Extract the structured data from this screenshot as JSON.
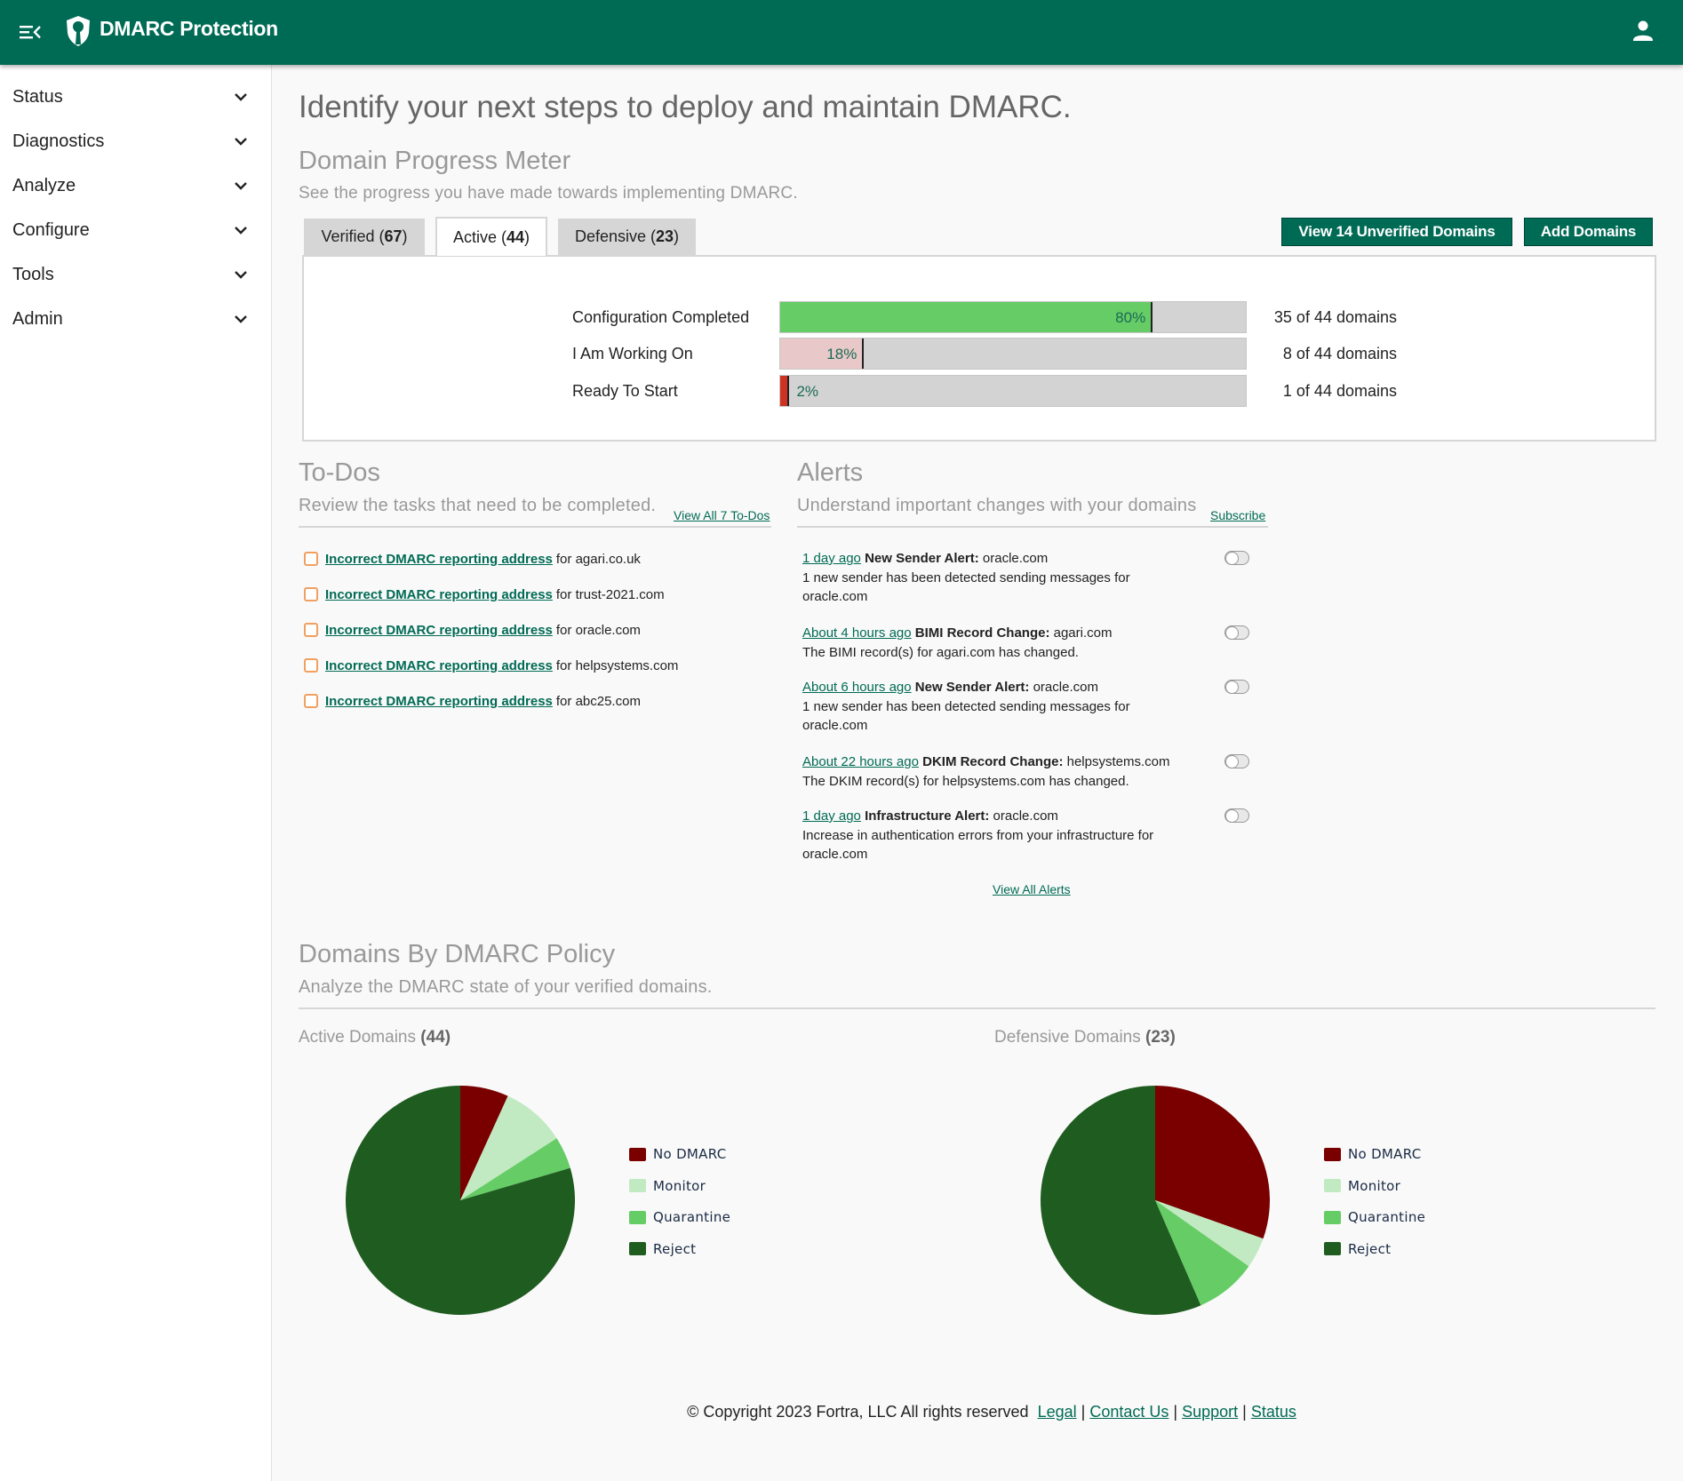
{
  "header": {
    "app_title": "DMARC Protection"
  },
  "sidebar": {
    "items": [
      {
        "label": "Status"
      },
      {
        "label": "Diagnostics"
      },
      {
        "label": "Analyze"
      },
      {
        "label": "Configure"
      },
      {
        "label": "Tools"
      },
      {
        "label": "Admin"
      }
    ]
  },
  "page": {
    "title": "Identify your next steps to deploy and maintain DMARC."
  },
  "progress_meter": {
    "title": "Domain Progress Meter",
    "subtitle": "See the progress you have made towards implementing DMARC.",
    "tabs": [
      {
        "label": "Verified",
        "count": "(67)",
        "count_num": "67",
        "active": false
      },
      {
        "label": "Active",
        "count": "(44)",
        "count_num": "44",
        "active": true
      },
      {
        "label": "Defensive",
        "count": "(23)",
        "count_num": "23",
        "active": false
      }
    ],
    "buttons": {
      "view_unverified": "View 14 Unverified Domains",
      "add_domains": "Add Domains"
    },
    "rows": [
      {
        "label": "Configuration Completed",
        "percent": 80,
        "percent_label": "80%",
        "count_label": "35 of 44 domains",
        "color": "#66cc66"
      },
      {
        "label": "I Am Working On",
        "percent": 18,
        "percent_label": "18%",
        "count_label": "8 of 44 domains",
        "color": "#e8c8c8"
      },
      {
        "label": "Ready To Start",
        "percent": 2,
        "percent_label": "2%",
        "count_label": "1 of 44 domains",
        "color": "#cc3322"
      }
    ]
  },
  "todos": {
    "title": "To-Dos",
    "subtitle": "Review the tasks that need to be completed.",
    "view_all": "View All 7 To-Dos",
    "items": [
      {
        "link": "Incorrect DMARC reporting address",
        "suffix": "for agari.co.uk"
      },
      {
        "link": "Incorrect DMARC reporting address",
        "suffix": "for trust-2021.com"
      },
      {
        "link": "Incorrect DMARC reporting address",
        "suffix": "for oracle.com"
      },
      {
        "link": "Incorrect DMARC reporting address",
        "suffix": "for helpsystems.com"
      },
      {
        "link": "Incorrect DMARC reporting address",
        "suffix": "for abc25.com"
      }
    ]
  },
  "alerts": {
    "title": "Alerts",
    "subtitle": "Understand important changes with your domains",
    "subscribe": "Subscribe",
    "view_all": "View All Alerts",
    "items": [
      {
        "time": "1 day ago",
        "type": "New Sender Alert:",
        "domain": "oracle.com",
        "description": "1 new sender has been detected sending messages for oracle.com",
        "enabled": false
      },
      {
        "time": "About 4 hours ago",
        "type": "BIMI Record Change:",
        "domain": "agari.com",
        "description": "The BIMI record(s) for agari.com has changed.",
        "enabled": false
      },
      {
        "time": "About 6 hours ago",
        "type": "New Sender Alert:",
        "domain": "oracle.com",
        "description": "1 new sender has been detected sending messages for oracle.com",
        "enabled": false
      },
      {
        "time": "About 22 hours ago",
        "type": "DKIM Record Change:",
        "domain": "helpsystems.com",
        "description": "The DKIM record(s) for helpsystems.com has changed.",
        "enabled": false
      },
      {
        "time": "1 day ago",
        "type": "Infrastructure Alert:",
        "domain": "oracle.com",
        "description": "Increase in authentication errors from your infrastructure for oracle.com",
        "enabled": false
      }
    ]
  },
  "policy": {
    "title": "Domains By DMARC Policy",
    "subtitle": "Analyze the DMARC state of your verified domains."
  },
  "chart_data": [
    {
      "type": "pie",
      "title": "Active Domains",
      "title_count": "(44)",
      "categories": [
        "No DMARC",
        "Monitor",
        "Quarantine",
        "Reject"
      ],
      "values": [
        3,
        4,
        2,
        35
      ],
      "colors": [
        "#7a0000",
        "#c2eac2",
        "#66cc66",
        "#1f5c20"
      ],
      "legend": "right"
    },
    {
      "type": "pie",
      "title": "Defensive Domains",
      "title_count": "(23)",
      "categories": [
        "No DMARC",
        "Monitor",
        "Quarantine",
        "Reject"
      ],
      "values": [
        7,
        1,
        2,
        13
      ],
      "colors": [
        "#7a0000",
        "#c2eac2",
        "#66cc66",
        "#1f5c20"
      ],
      "legend": "right"
    }
  ],
  "footer": {
    "copyright": "© Copyright 2023 Fortra, LLC All rights reserved",
    "links": [
      "Legal",
      "Contact Us",
      "Support",
      "Status"
    ],
    "separator": "|"
  }
}
